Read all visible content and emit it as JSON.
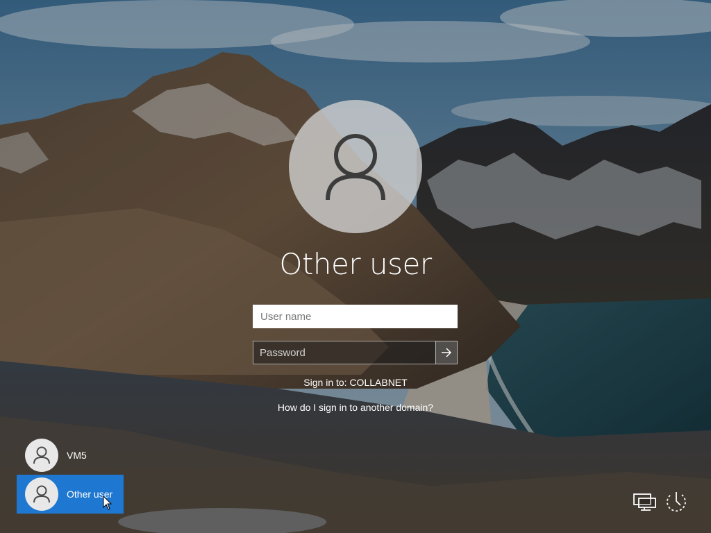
{
  "signin": {
    "title": "Other user",
    "username_placeholder": "User name",
    "password_placeholder": "Password",
    "sign_in_to": "Sign in to: COLLABNET",
    "domain_help": "How do I sign in to another domain?"
  },
  "users": [
    {
      "label": "VM5",
      "selected": false
    },
    {
      "label": "Other user",
      "selected": true
    }
  ],
  "icons": {
    "submit": "arrow-right-icon",
    "network": "network-icon",
    "power": "power-icon",
    "avatar": "person-icon"
  },
  "colors": {
    "selection_accent": "#1e77d0"
  }
}
